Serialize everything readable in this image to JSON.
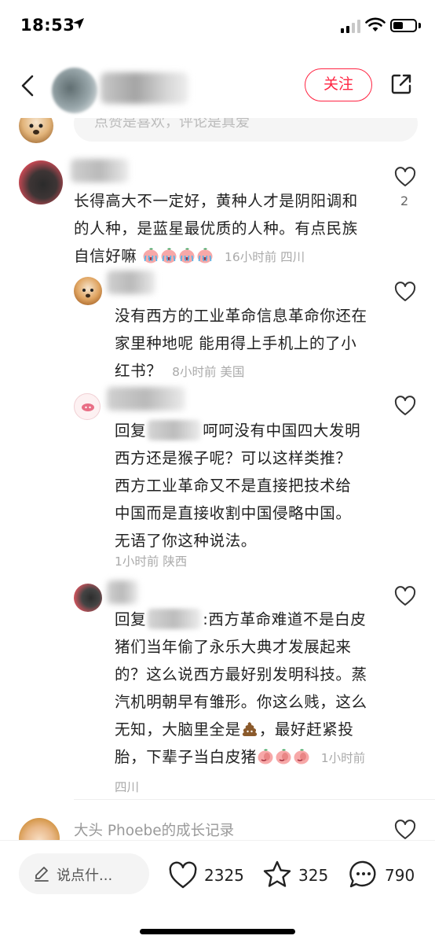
{
  "status": {
    "time": "18:53"
  },
  "header": {
    "follow_label": "关注"
  },
  "prev_comment": {
    "input_placeholder": "点赞是喜欢，评论是真爱"
  },
  "comments": [
    {
      "text": "长得高大不一定好，黄种人才是阴阳调和的人种，是蓝星最优质的人种。有点民族自信好嘛",
      "emoji_count": 4,
      "meta": "16小时前 四川",
      "likes": "2"
    },
    {
      "text": "没有西方的工业革命信息革命你还在家里种地呢 能用得上手机上的了小红书？",
      "meta": "8小时前 美国"
    },
    {
      "reply_prefix": "回复",
      "text": "呵呵没有中国四大发明西方还是猴子呢？可以这样类推？西方工业革命又不是直接把技术给中国而是直接收割中国侵略中国。无语了你这种说法。",
      "meta": "1小时前 陕西"
    },
    {
      "reply_prefix": "回复",
      "text_a": ":西方革命难道不是白皮猪们当年偷了永乐大典才发展起来的？这么说西方最好别发明科技。蒸汽机明朝早有雏形。你这么贱，这么无知，大脑里全是",
      "text_b": "，最好赶紧投胎，下辈子当白皮猪",
      "meta": "1小时前 四川"
    }
  ],
  "next_comment": {
    "username": "大头 Phoebe的成长记录"
  },
  "bottom": {
    "say_placeholder": "说点什...",
    "like_count": "2325",
    "star_count": "325",
    "comment_count": "790"
  },
  "icons": {
    "back": "back-arrow-icon",
    "share": "share-icon",
    "heart": "heart-icon",
    "star": "star-icon",
    "comment": "comment-bubble-icon",
    "pen": "pen-icon"
  },
  "colors": {
    "accent": "#ff2442",
    "meta_text": "#aaaaaa"
  }
}
